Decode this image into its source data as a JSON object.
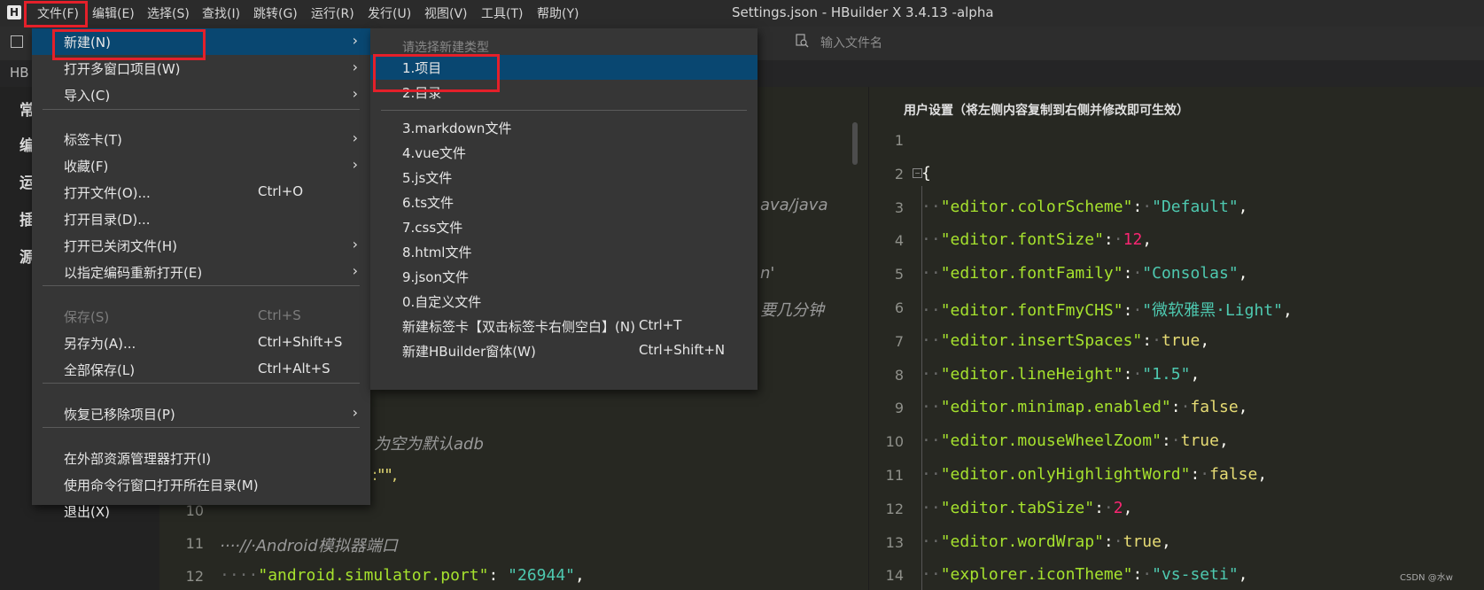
{
  "menubar": {
    "logo": "H",
    "items": [
      "文件(F)",
      "编辑(E)",
      "选择(S)",
      "查找(I)",
      "跳转(G)",
      "运行(R)",
      "发行(U)",
      "视图(V)",
      "工具(T)",
      "帮助(Y)"
    ],
    "window_title": "Settings.json - HBuilder X 3.4.13 -alpha"
  },
  "toolbar": {
    "search_placeholder": "输入文件名"
  },
  "tabbar": {
    "tab_label": "HB"
  },
  "sidebar": {
    "labels": [
      "常",
      "编",
      "运",
      "插",
      "源"
    ]
  },
  "file_menu": {
    "items": [
      {
        "label": "新建(N)",
        "shortcut": "",
        "submenu": true,
        "active": true
      },
      {
        "label": "打开多窗口项目(W)",
        "shortcut": "",
        "submenu": true
      },
      {
        "label": "导入(C)",
        "shortcut": "",
        "submenu": true
      },
      {
        "label": "标签卡(T)",
        "shortcut": "",
        "submenu": true
      },
      {
        "label": "收藏(F)",
        "shortcut": "",
        "submenu": true
      },
      {
        "label": "打开文件(O)...",
        "shortcut": "Ctrl+O"
      },
      {
        "label": "打开目录(D)...",
        "shortcut": ""
      },
      {
        "label": "打开已关闭文件(H)",
        "shortcut": "",
        "submenu": true
      },
      {
        "label": "以指定编码重新打开(E)",
        "shortcut": "",
        "submenu": true
      },
      {
        "label": "保存(S)",
        "shortcut": "Ctrl+S",
        "disabled": true
      },
      {
        "label": "另存为(A)...",
        "shortcut": "Ctrl+Shift+S"
      },
      {
        "label": "全部保存(L)",
        "shortcut": "Ctrl+Alt+S"
      },
      {
        "label": "恢复已移除项目(P)",
        "shortcut": "",
        "submenu": true
      },
      {
        "label": "在外部资源管理器打开(I)",
        "shortcut": ""
      },
      {
        "label": "使用命令行窗口打开所在目录(M)",
        "shortcut": ""
      },
      {
        "label": "退出(X)",
        "shortcut": ""
      }
    ]
  },
  "new_submenu": {
    "header": "请选择新建类型",
    "items": [
      {
        "label": "1.项目",
        "shortcut": "",
        "active": true
      },
      {
        "label": "2.目录",
        "shortcut": ""
      },
      {
        "label": "3.markdown文件",
        "shortcut": ""
      },
      {
        "label": "4.vue文件",
        "shortcut": ""
      },
      {
        "label": "5.js文件",
        "shortcut": ""
      },
      {
        "label": "6.ts文件",
        "shortcut": ""
      },
      {
        "label": "7.css文件",
        "shortcut": ""
      },
      {
        "label": "8.html文件",
        "shortcut": ""
      },
      {
        "label": "9.json文件",
        "shortcut": ""
      },
      {
        "label": "0.自定义文件",
        "shortcut": ""
      },
      {
        "label": "新建标签卡【双击标签卡右侧空白】(N)",
        "shortcut": "Ctrl+T"
      },
      {
        "label": "新建HBuilder窗体(W)",
        "shortcut": "Ctrl+Shift+N"
      }
    ]
  },
  "left_editor": {
    "fragments": [
      "ava/java",
      "n'",
      "要几分钟",
      "器，为空为默认adb",
      ":\"\","
    ],
    "lines": [
      {
        "num": "10",
        "text": ""
      },
      {
        "num": "11",
        "text": "····//·Android模拟器端口"
      },
      {
        "num": "12",
        "key": "\"android.simulator.port\"",
        "val": "\"26944\""
      }
    ]
  },
  "right_editor": {
    "title": "用户设置（将左侧内容复制到右侧并修改即可生效）",
    "lines": [
      {
        "num": "1",
        "key": "",
        "val": "",
        "type": "empty"
      },
      {
        "num": "2",
        "key": "",
        "val": "{",
        "type": "brace"
      },
      {
        "num": "3",
        "key": "\"editor.colorScheme\"",
        "val": "\"Default\"",
        "type": "string"
      },
      {
        "num": "4",
        "key": "\"editor.fontSize\"",
        "val": "12",
        "type": "number"
      },
      {
        "num": "5",
        "key": "\"editor.fontFamily\"",
        "val": "\"Consolas\"",
        "type": "string"
      },
      {
        "num": "6",
        "key": "\"editor.fontFmyCHS\"",
        "val": "\"微软雅黑·Light\"",
        "type": "string"
      },
      {
        "num": "7",
        "key": "\"editor.insertSpaces\"",
        "val": "true",
        "type": "bool"
      },
      {
        "num": "8",
        "key": "\"editor.lineHeight\"",
        "val": "\"1.5\"",
        "type": "string"
      },
      {
        "num": "9",
        "key": "\"editor.minimap.enabled\"",
        "val": "false",
        "type": "bool"
      },
      {
        "num": "10",
        "key": "\"editor.mouseWheelZoom\"",
        "val": "true",
        "type": "bool"
      },
      {
        "num": "11",
        "key": "\"editor.onlyHighlightWord\"",
        "val": "false",
        "type": "bool"
      },
      {
        "num": "12",
        "key": "\"editor.tabSize\"",
        "val": "2",
        "type": "number"
      },
      {
        "num": "13",
        "key": "\"editor.wordWrap\"",
        "val": "true",
        "type": "bool"
      },
      {
        "num": "14",
        "key": "\"explorer.iconTheme\"",
        "val": "\"vs-seti\"",
        "type": "string"
      }
    ]
  },
  "watermark": "CSDN @水w",
  "colors": {
    "menu_bg": "#363636",
    "menu_active": "#094771",
    "highlight_box": "#e4202a",
    "editor_bg": "#272822",
    "json_key": "#a6e22e",
    "json_string": "#4ec9b0",
    "json_number": "#f92672",
    "json_bool": "#e6db74"
  }
}
